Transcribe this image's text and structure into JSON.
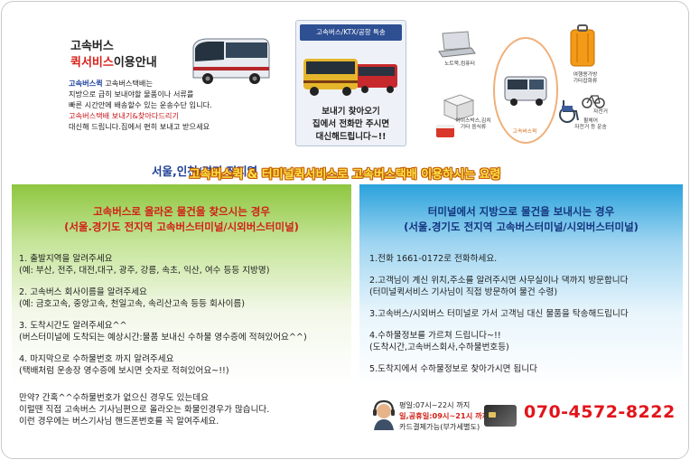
{
  "intro": {
    "title_line1": "고속버스",
    "title_red": "퀵서비스",
    "title_suffix": "이용안내",
    "desc_blue": "고속버스퀵",
    "desc_line1_rest": " 고속버스택배는",
    "desc_line2": "지방으로 급히 보내야할 물품이나 서류를",
    "desc_line3": "빠른 시간안에 배송할수 있는 운송수단 입니다.",
    "desc_red": "고속버스택배 보내기&찾아다드리기",
    "desc_line5": "대신해 드립니다.집에서 편히 보내고 받으세요",
    "region": "서울,인천/경기 전지역"
  },
  "express_box": {
    "header": "고속버스/KTX/공항 특송",
    "line1": "보내기 찾아오기",
    "line2": "집에서 전화만 주시면",
    "line3": "대신해드립니다~!!"
  },
  "diagram": {
    "laptop": "노트북,컴퓨터",
    "parcel": "아이스박스,김치",
    "parcel2": "기타 음식류",
    "carrier": "여행용가방",
    "carrier2": "기타잡화류",
    "bike": "자전거",
    "wheelchair": "휠체어",
    "wheelchair2": "자전거 등 운송",
    "center": "고속버스퀵"
  },
  "heading": "고속버스퀵 & 터미널퀵서비스로 고속버스택배 이용하시는 요령",
  "left_panel": {
    "title1": "고속버스로 올라온 물건을 찾으시는 경우",
    "title2": "(서울.경기도 전지역 고속버스터미널/시외버스터미널)",
    "steps": [
      {
        "main": "1. 출발지역을 알려주세요",
        "sub": "(예: 부산, 전주, 대전,대구, 광주, 강릉, 속초, 익산, 여수 등등 지방명)"
      },
      {
        "main": "2. 고속버스 회사이름을 알려주세요",
        "sub": "(예: 금호고속, 중앙고속, 천일고속, 속리산고속 등등 회사이름)"
      },
      {
        "main": "3. 도착시간도 알려주세요^^",
        "sub": "(버스터미널에 도착되는 예상시간:물품 보내신 수하물 영수증에 적혀있어요^^)"
      },
      {
        "main": "4. 마지막으로 수하물번호 까지 알려주세요",
        "sub": "(택배처럼 운송장 영수증에 보시면 숫자로 적혀있어요~!!)"
      }
    ],
    "note1": "만약? 간혹^^수하물번호가 없으신 경우도 있는데요",
    "note2": "이럴땐 직접 고속버스 기사님편으로 올라오는 화물인경우가 많습니다.",
    "note3": "이런 경우에는 버스기사님 핸드폰번호를 꼭 알여주세요."
  },
  "right_panel": {
    "title1": "터미널에서 지방으로 물건을 보내시는 경우",
    "title2": "(서울.경기도 전지역 고속버스터미널/시외버스터미널)",
    "steps": [
      {
        "main": "1.전화 1661-0172로 전화하세요.",
        "sub": ""
      },
      {
        "main": "2.고객님이 계신 위치,주소를 알려주시면 사무실이나 댁까지 방문합니다",
        "sub": "(터미널퀵서비스 기사님이 직접 방문하여 물건 수령)"
      },
      {
        "main": "3.고속버스/시외버스 터미널로 가서 고객님 대신 물품을 탁송해드립니다",
        "sub": ""
      },
      {
        "main": "4.수하물정보를 가르쳐 드립니다~!!",
        "sub": "(도착시간,고속버스회사,수하물번호등)"
      },
      {
        "main": "5.도착지에서 수하물정보로 찾아가시면 됩니다",
        "sub": ""
      }
    ],
    "hours1": "평일:07시~22시 까지",
    "hours2": "일,공휴일:09시~21시 까지",
    "hours3": "카드결제가능(부가세별도)",
    "phone": "070-4572-8222"
  }
}
